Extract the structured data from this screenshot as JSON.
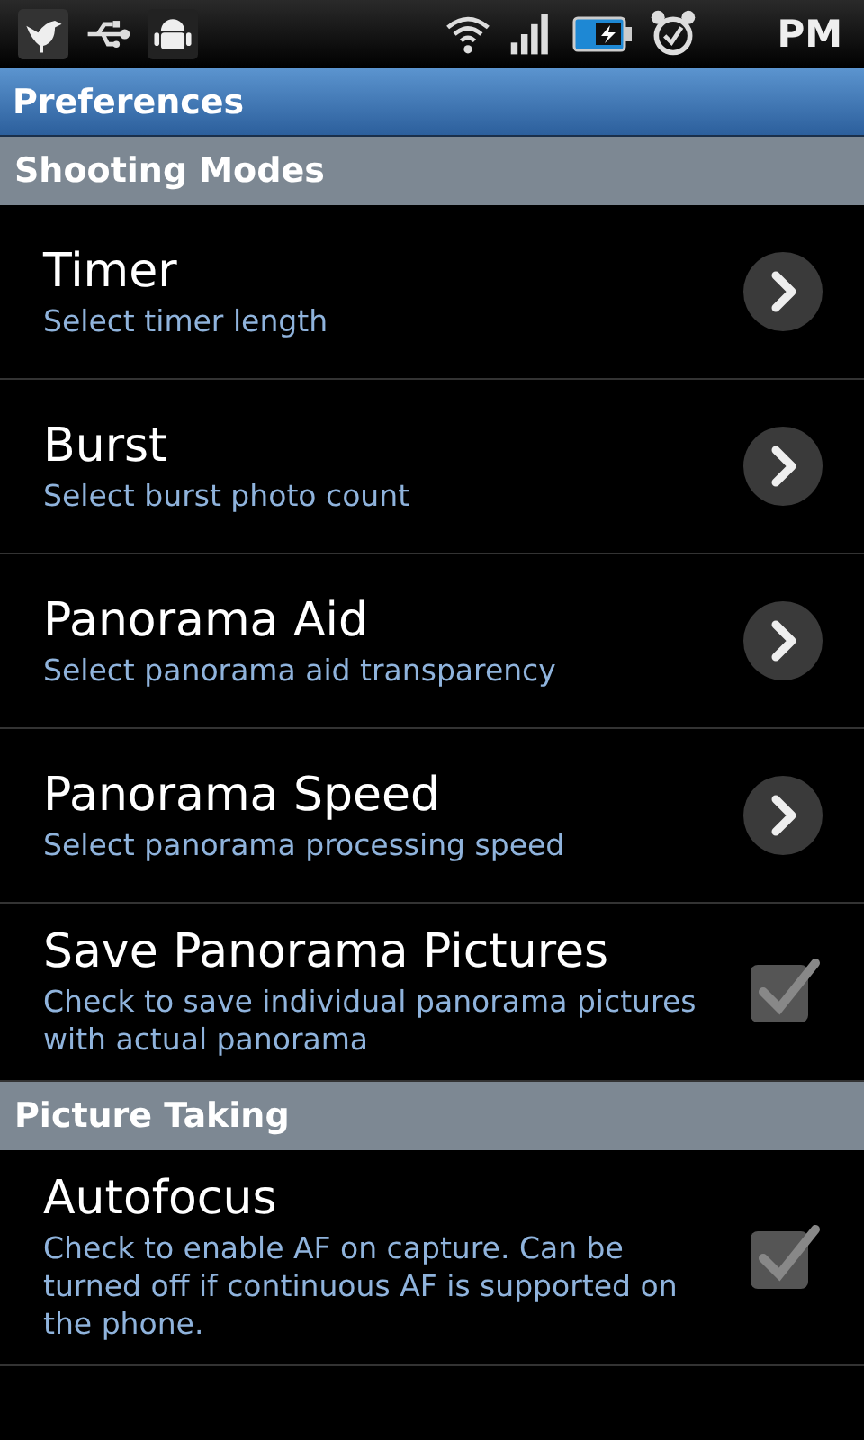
{
  "status_bar": {
    "time": "PM"
  },
  "title_bar": {
    "title": "Preferences"
  },
  "sections": [
    {
      "title": "Shooting Modes",
      "items": [
        {
          "kind": "link",
          "title": "Timer",
          "summary": "Select timer length"
        },
        {
          "kind": "link",
          "title": "Burst",
          "summary": "Select burst photo count"
        },
        {
          "kind": "link",
          "title": "Panorama Aid",
          "summary": "Select panorama aid transparency"
        },
        {
          "kind": "link",
          "title": "Panorama Speed",
          "summary": "Select panorama processing speed"
        },
        {
          "kind": "checkbox",
          "title": "Save Panorama Pictures",
          "summary": "Check to save individual panorama pictures with actual panorama",
          "checked": true
        }
      ]
    },
    {
      "title": "Picture Taking",
      "items": [
        {
          "kind": "checkbox",
          "title": "Autofocus",
          "summary": "Check to enable AF on capture. Can be turned off if continuous AF is supported on the phone.",
          "checked": true
        }
      ]
    }
  ]
}
